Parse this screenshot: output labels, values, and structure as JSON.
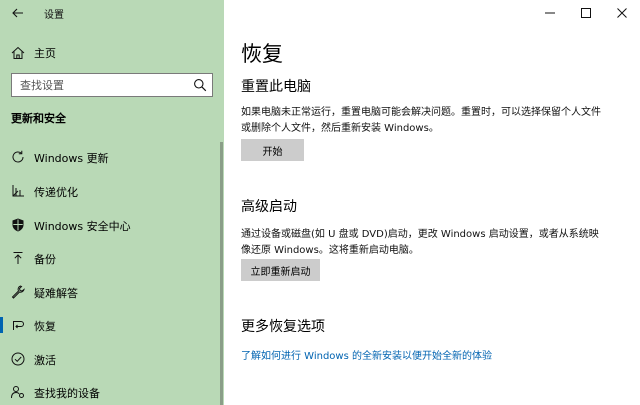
{
  "app": {
    "title": "设置"
  },
  "sidebar": {
    "home_label": "主页",
    "search_placeholder": "查找设置",
    "section_title": "更新和安全",
    "items": [
      {
        "label": "Windows 更新",
        "icon": "refresh-icon"
      },
      {
        "label": "传递优化",
        "icon": "delivery-optimization-icon"
      },
      {
        "label": "Windows 安全中心",
        "icon": "shield-icon"
      },
      {
        "label": "备份",
        "icon": "backup-arrow-icon"
      },
      {
        "label": "疑难解答",
        "icon": "wrench-icon"
      },
      {
        "label": "恢复",
        "icon": "recovery-icon",
        "active": true
      },
      {
        "label": "激活",
        "icon": "check-circle-icon"
      },
      {
        "label": "查找我的设备",
        "icon": "person-locate-icon"
      }
    ]
  },
  "main": {
    "title": "恢复",
    "reset": {
      "heading": "重置此电脑",
      "desc": "如果电脑未正常运行，重置电脑可能会解决问题。重置时，可以选择保留个人文件或删除个人文件，然后重新安装 Windows。",
      "button": "开始"
    },
    "advanced": {
      "heading": "高级启动",
      "desc": "通过设备或磁盘(如 U 盘或 DVD)启动，更改 Windows 启动设置，或者从系统映像还原 Windows。这将重新启动电脑。",
      "button": "立即重新启动"
    },
    "more": {
      "heading": "更多恢复选项",
      "link": "了解如何进行 Windows 的全新安装以便开始全新的体验"
    }
  },
  "colors": {
    "sidebar_bg": "#b9d9b6",
    "accent": "#0063b1",
    "button_bg": "#cccccc"
  }
}
